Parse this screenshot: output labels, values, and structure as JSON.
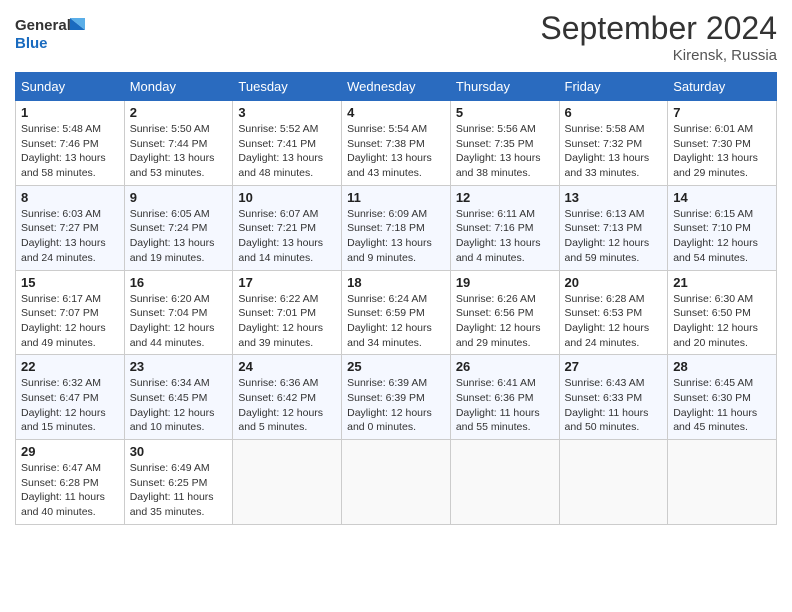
{
  "logo": {
    "line1": "General",
    "line2": "Blue"
  },
  "title": "September 2024",
  "location": "Kirensk, Russia",
  "days_header": [
    "Sunday",
    "Monday",
    "Tuesday",
    "Wednesday",
    "Thursday",
    "Friday",
    "Saturday"
  ],
  "weeks": [
    [
      {
        "num": "1",
        "info": "Sunrise: 5:48 AM\nSunset: 7:46 PM\nDaylight: 13 hours\nand 58 minutes."
      },
      {
        "num": "2",
        "info": "Sunrise: 5:50 AM\nSunset: 7:44 PM\nDaylight: 13 hours\nand 53 minutes."
      },
      {
        "num": "3",
        "info": "Sunrise: 5:52 AM\nSunset: 7:41 PM\nDaylight: 13 hours\nand 48 minutes."
      },
      {
        "num": "4",
        "info": "Sunrise: 5:54 AM\nSunset: 7:38 PM\nDaylight: 13 hours\nand 43 minutes."
      },
      {
        "num": "5",
        "info": "Sunrise: 5:56 AM\nSunset: 7:35 PM\nDaylight: 13 hours\nand 38 minutes."
      },
      {
        "num": "6",
        "info": "Sunrise: 5:58 AM\nSunset: 7:32 PM\nDaylight: 13 hours\nand 33 minutes."
      },
      {
        "num": "7",
        "info": "Sunrise: 6:01 AM\nSunset: 7:30 PM\nDaylight: 13 hours\nand 29 minutes."
      }
    ],
    [
      {
        "num": "8",
        "info": "Sunrise: 6:03 AM\nSunset: 7:27 PM\nDaylight: 13 hours\nand 24 minutes."
      },
      {
        "num": "9",
        "info": "Sunrise: 6:05 AM\nSunset: 7:24 PM\nDaylight: 13 hours\nand 19 minutes."
      },
      {
        "num": "10",
        "info": "Sunrise: 6:07 AM\nSunset: 7:21 PM\nDaylight: 13 hours\nand 14 minutes."
      },
      {
        "num": "11",
        "info": "Sunrise: 6:09 AM\nSunset: 7:18 PM\nDaylight: 13 hours\nand 9 minutes."
      },
      {
        "num": "12",
        "info": "Sunrise: 6:11 AM\nSunset: 7:16 PM\nDaylight: 13 hours\nand 4 minutes."
      },
      {
        "num": "13",
        "info": "Sunrise: 6:13 AM\nSunset: 7:13 PM\nDaylight: 12 hours\nand 59 minutes."
      },
      {
        "num": "14",
        "info": "Sunrise: 6:15 AM\nSunset: 7:10 PM\nDaylight: 12 hours\nand 54 minutes."
      }
    ],
    [
      {
        "num": "15",
        "info": "Sunrise: 6:17 AM\nSunset: 7:07 PM\nDaylight: 12 hours\nand 49 minutes."
      },
      {
        "num": "16",
        "info": "Sunrise: 6:20 AM\nSunset: 7:04 PM\nDaylight: 12 hours\nand 44 minutes."
      },
      {
        "num": "17",
        "info": "Sunrise: 6:22 AM\nSunset: 7:01 PM\nDaylight: 12 hours\nand 39 minutes."
      },
      {
        "num": "18",
        "info": "Sunrise: 6:24 AM\nSunset: 6:59 PM\nDaylight: 12 hours\nand 34 minutes."
      },
      {
        "num": "19",
        "info": "Sunrise: 6:26 AM\nSunset: 6:56 PM\nDaylight: 12 hours\nand 29 minutes."
      },
      {
        "num": "20",
        "info": "Sunrise: 6:28 AM\nSunset: 6:53 PM\nDaylight: 12 hours\nand 24 minutes."
      },
      {
        "num": "21",
        "info": "Sunrise: 6:30 AM\nSunset: 6:50 PM\nDaylight: 12 hours\nand 20 minutes."
      }
    ],
    [
      {
        "num": "22",
        "info": "Sunrise: 6:32 AM\nSunset: 6:47 PM\nDaylight: 12 hours\nand 15 minutes."
      },
      {
        "num": "23",
        "info": "Sunrise: 6:34 AM\nSunset: 6:45 PM\nDaylight: 12 hours\nand 10 minutes."
      },
      {
        "num": "24",
        "info": "Sunrise: 6:36 AM\nSunset: 6:42 PM\nDaylight: 12 hours\nand 5 minutes."
      },
      {
        "num": "25",
        "info": "Sunrise: 6:39 AM\nSunset: 6:39 PM\nDaylight: 12 hours\nand 0 minutes."
      },
      {
        "num": "26",
        "info": "Sunrise: 6:41 AM\nSunset: 6:36 PM\nDaylight: 11 hours\nand 55 minutes."
      },
      {
        "num": "27",
        "info": "Sunrise: 6:43 AM\nSunset: 6:33 PM\nDaylight: 11 hours\nand 50 minutes."
      },
      {
        "num": "28",
        "info": "Sunrise: 6:45 AM\nSunset: 6:30 PM\nDaylight: 11 hours\nand 45 minutes."
      }
    ],
    [
      {
        "num": "29",
        "info": "Sunrise: 6:47 AM\nSunset: 6:28 PM\nDaylight: 11 hours\nand 40 minutes."
      },
      {
        "num": "30",
        "info": "Sunrise: 6:49 AM\nSunset: 6:25 PM\nDaylight: 11 hours\nand 35 minutes."
      },
      null,
      null,
      null,
      null,
      null
    ]
  ]
}
